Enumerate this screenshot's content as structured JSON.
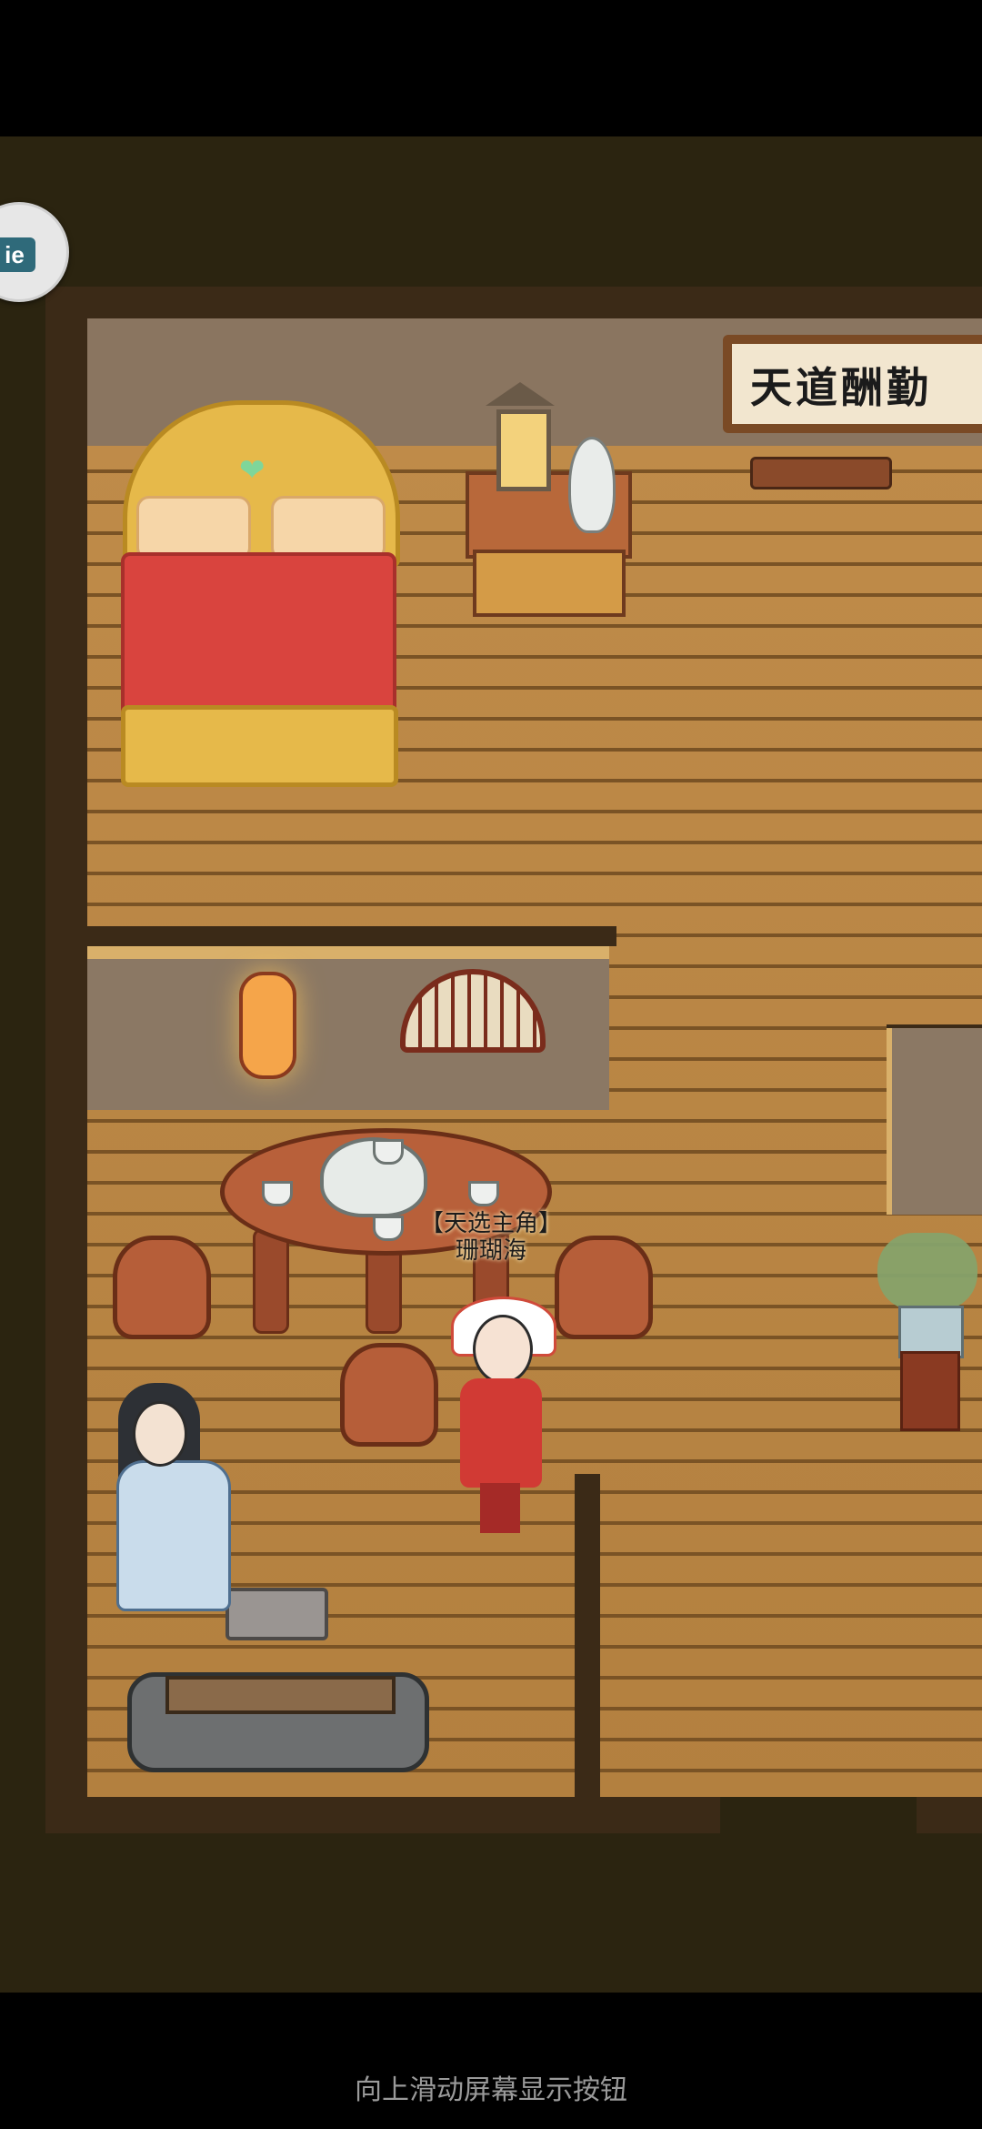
{
  "sign": {
    "text": "天道酬勤"
  },
  "hero": {
    "title": "【天选主角】",
    "name": "珊瑚海"
  },
  "float_button": {
    "label": "ie",
    "icon": "app-shortcut-icon"
  },
  "system": {
    "gesture_hint": "向上滑动屏幕显示按钮"
  },
  "colors": {
    "floor": "#c08c4a",
    "wall": "#3b2a17",
    "bed_blanket": "#d9443e",
    "gold_trim": "#e6b94a"
  }
}
